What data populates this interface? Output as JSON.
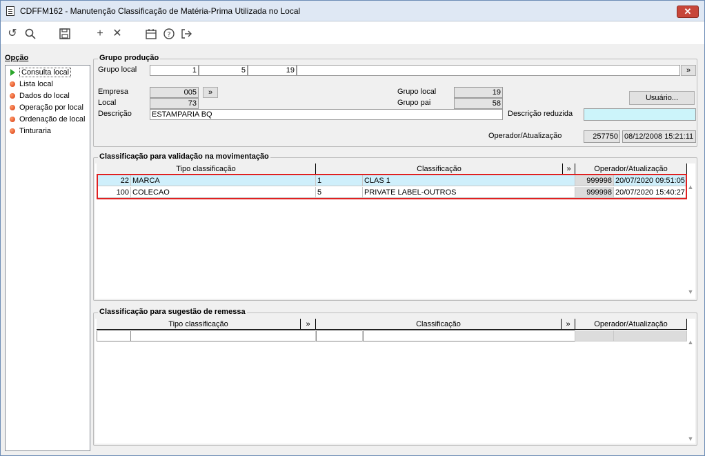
{
  "window": {
    "title": "CDFFM162 - Manutenção Classificação de Matéria-Prima Utilizada no Local",
    "close_label": "✕"
  },
  "toolbar": {
    "icons": [
      "refresh-icon",
      "search-icon",
      "save-icon",
      "add-icon",
      "delete-icon",
      "calendar-icon",
      "help-icon",
      "exit-icon"
    ]
  },
  "opcao": {
    "label": "Opção",
    "items": [
      "Consulta local",
      "Lista local",
      "Dados do local",
      "Operação por local",
      "Ordenação de local",
      "Tinturaria"
    ]
  },
  "grupo_producao": {
    "title": "Grupo produção",
    "grupo_local_label": "Grupo local",
    "grupo_local_values": [
      "1",
      "5",
      "19"
    ],
    "more_button": "»",
    "empresa_label": "Empresa",
    "empresa_value": "005",
    "empresa_button": "»",
    "local_label": "Local",
    "local_value": "73",
    "descricao_label": "Descrição",
    "descricao_value": "ESTAMPARIA BQ",
    "grupo_local2_label": "Grupo local",
    "grupo_local2_value": "19",
    "grupo_pai_label": "Grupo pai",
    "grupo_pai_value": "58",
    "usuario_button": "Usuário...",
    "descricao_reduzida_label": "Descrição reduzida",
    "descricao_reduzida_value": "",
    "operador_label": "Operador/Atualização",
    "operador_value": "257750",
    "atualizacao_value": "08/12/2008 15:21:11"
  },
  "validacao": {
    "title": "Classificação para validação na movimentação",
    "headers": [
      "Tipo classificação",
      "Classificação",
      "»",
      "Operador/Atualização"
    ],
    "rows": [
      {
        "code": "22",
        "tipo": "MARCA",
        "clas_code": "1",
        "clas": "CLAS 1",
        "operador": "999998",
        "data": "20/07/2020 09:51:05"
      },
      {
        "code": "100",
        "tipo": "COLECAO",
        "clas_code": "5",
        "clas": "PRIVATE LABEL-OUTROS",
        "operador": "999998",
        "data": "20/07/2020 15:40:27"
      }
    ]
  },
  "sugestao": {
    "title": "Classificação para sugestão de remessa",
    "headers": [
      "Tipo classificação",
      "»",
      "Classificação",
      "»",
      "Operador/Atualização"
    ]
  },
  "colors": {
    "title_bar": "#dfe8f4",
    "close": "#c7463a",
    "highlight": "#e02020",
    "cyan": "#ccf4fa"
  }
}
